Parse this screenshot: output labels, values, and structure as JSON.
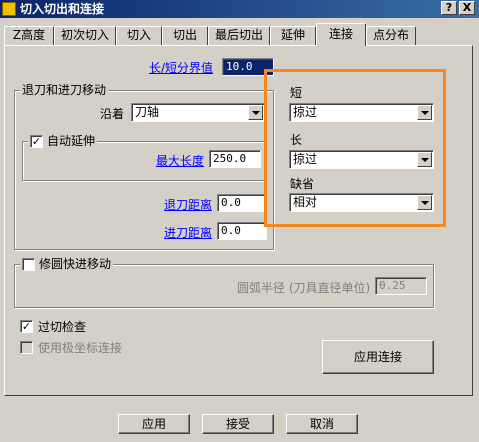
{
  "window": {
    "title": "切入切出和连接",
    "help_label": "?",
    "close_label": "X"
  },
  "tabs": [
    "Z高度",
    "初次切入",
    "切入",
    "切出",
    "最后切出",
    "延伸",
    "连接",
    "点分布"
  ],
  "active_tab_index": 6,
  "length_threshold": {
    "label": "长/短分界值",
    "value": "10.0"
  },
  "retract_group": {
    "title": "退刀和进刀移动",
    "along_label": "沿着",
    "along_value": "刀轴",
    "auto_extend": {
      "label": "自动延伸",
      "checked": true,
      "check_mark": "✓",
      "max_length_label": "最大长度",
      "max_length_value": "250.0"
    },
    "retract_distance_label": "退刀距离",
    "retract_distance_value": "0.0",
    "approach_distance_label": "进刀距离",
    "approach_distance_value": "0.0"
  },
  "link_types": {
    "short_label": "短",
    "short_value": "掠过",
    "long_label": "长",
    "long_value": "掠过",
    "default_label": "缺省",
    "default_value": "相对"
  },
  "arc_group": {
    "title": "修圆快进移动",
    "checked": false,
    "radius_label": "圆弧半径 (刀具直径单位)",
    "radius_value": "0.25"
  },
  "gouge_check": {
    "label": "过切检查",
    "checked": true,
    "check_mark": "✓"
  },
  "polar": {
    "label": "使用极坐标连接",
    "checked": false
  },
  "apply_links_label": "应用连接",
  "footer": {
    "apply": "应用",
    "accept": "接受",
    "cancel": "取消"
  },
  "accent_color": "#f7861e"
}
